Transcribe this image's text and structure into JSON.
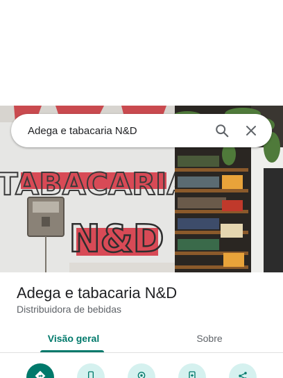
{
  "search": {
    "query": "Adega e tabacaria N&D"
  },
  "photo": {
    "sign_texts": [
      "TABACARIA",
      "N&D"
    ]
  },
  "place": {
    "name": "Adega e tabacaria N&D",
    "category": "Distribuidora de bebidas"
  },
  "tabs": [
    {
      "label": "Visão geral",
      "selected": true
    },
    {
      "label": "Sobre",
      "selected": false
    }
  ],
  "actions": [
    {
      "icon": "directions-icon"
    },
    {
      "icon": "phone-icon"
    },
    {
      "icon": "save-pin-icon"
    },
    {
      "icon": "add-to-phone-icon"
    },
    {
      "icon": "share-icon"
    }
  ],
  "colors": {
    "accent": "#00796b",
    "accent_light": "#d5f1ef",
    "text_primary": "#202124",
    "text_secondary": "#5f6368"
  }
}
